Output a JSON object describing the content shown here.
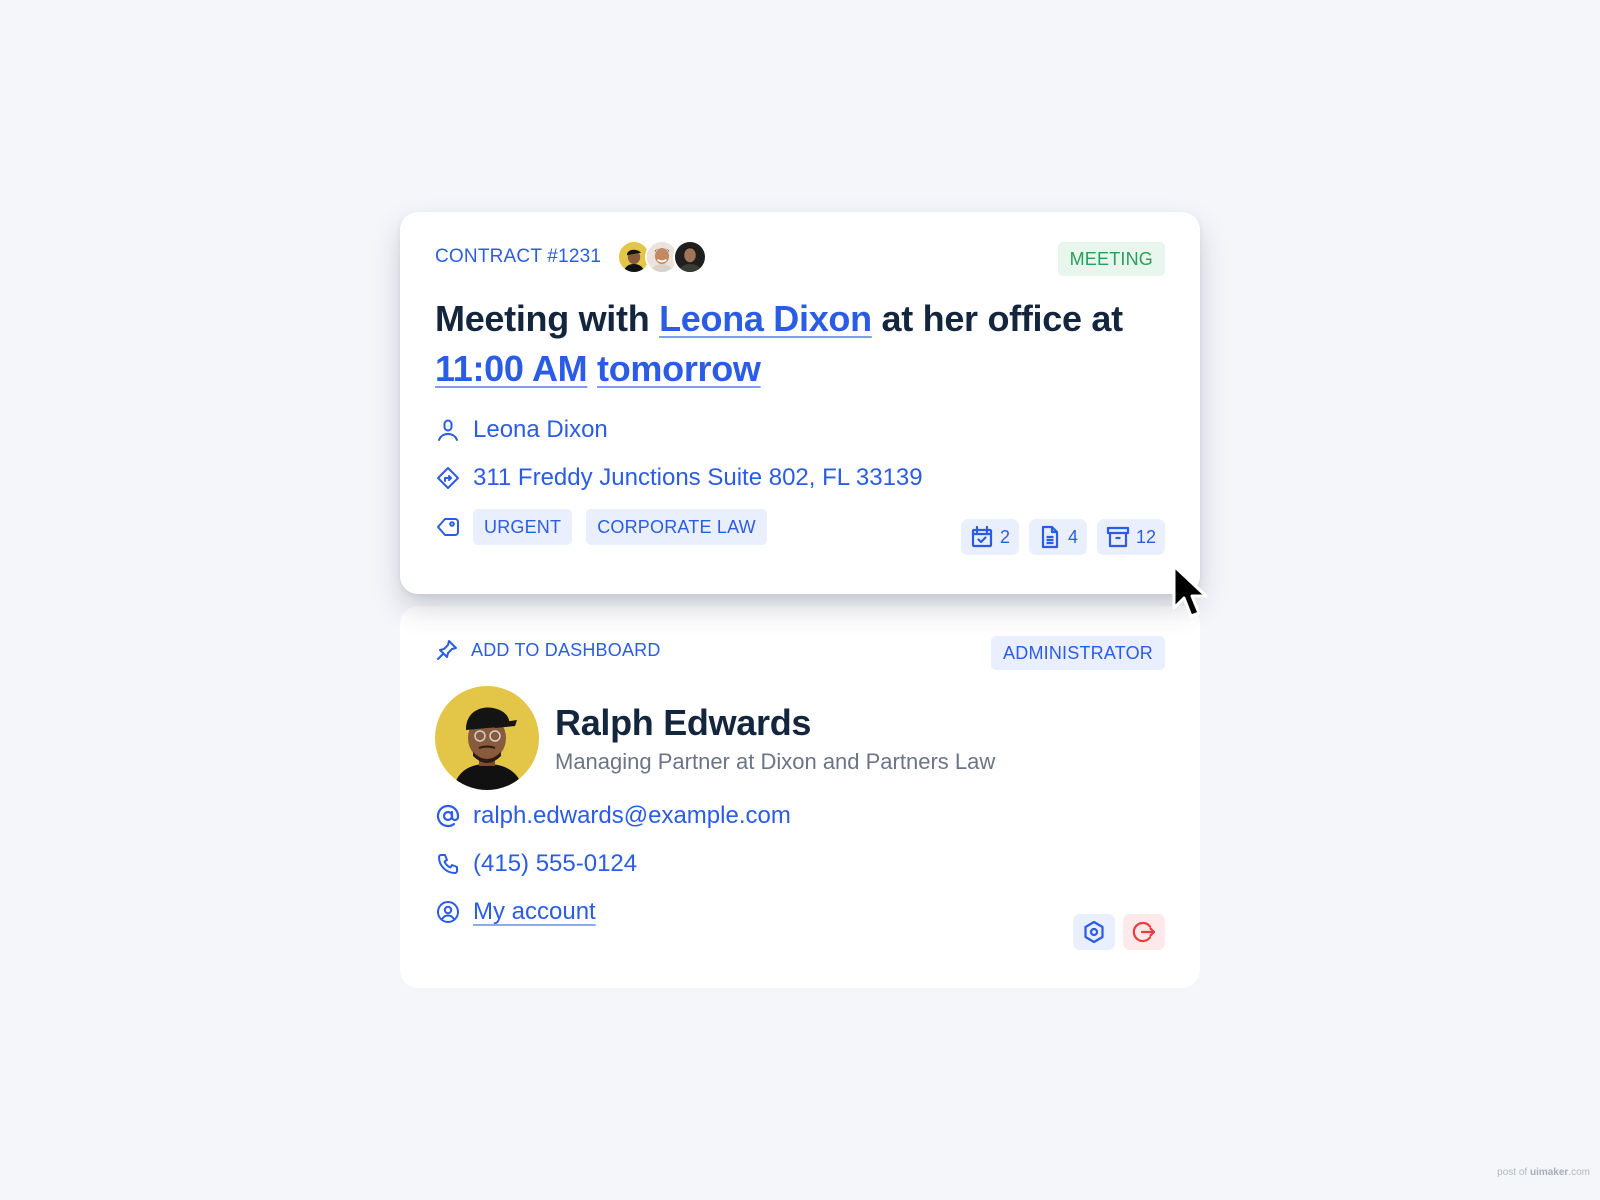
{
  "contract_card": {
    "contract_label": "CONTRACT #1231",
    "participants": [
      {
        "name": "participant-1",
        "bg": "#e3c548"
      },
      {
        "name": "participant-2",
        "bg": "#e9dfd6"
      },
      {
        "name": "participant-3",
        "bg": "#2a2a2a"
      }
    ],
    "type_badge": "MEETING",
    "title": {
      "part1": "Meeting with ",
      "person_link": "Leona Dixon",
      "part2": " at her office at ",
      "time_link": "11:00 AM",
      "part3": " ",
      "day_link": "tomorrow"
    },
    "contact_name": "Leona Dixon",
    "address": "311 Freddy Junctions Suite 802, FL 33139",
    "tags": [
      "URGENT",
      "CORPORATE LAW"
    ],
    "counters": [
      {
        "icon": "calendar-check-icon",
        "value": "2"
      },
      {
        "icon": "document-icon",
        "value": "4"
      },
      {
        "icon": "archive-icon",
        "value": "12"
      }
    ]
  },
  "profile_card": {
    "pin_label": "ADD TO DASHBOARD",
    "role_badge": "ADMINISTRATOR",
    "name": "Ralph Edwards",
    "title": "Managing Partner at Dixon and Partners Law",
    "email": "ralph.edwards@example.com",
    "phone": "(415) 555-0124",
    "account_link": "My account"
  },
  "watermark": {
    "prefix": "post of ",
    "brand": "uimaker",
    "suffix": ".com"
  },
  "colors": {
    "accent": "#2b5ce6",
    "text_dark": "#14263d",
    "meeting_green": "#26a05a",
    "logout_red": "#ef3b3b"
  }
}
